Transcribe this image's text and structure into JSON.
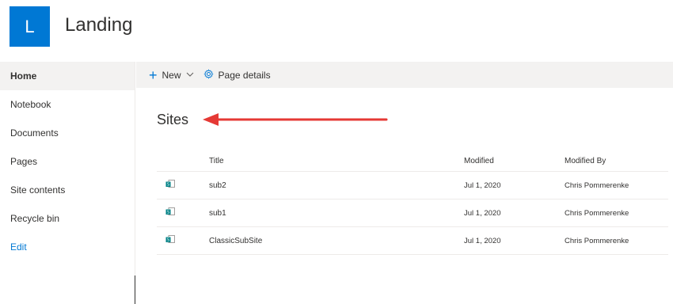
{
  "header": {
    "logo_letter": "L",
    "title": "Landing"
  },
  "nav": {
    "items": [
      {
        "label": "Home"
      },
      {
        "label": "Notebook"
      },
      {
        "label": "Documents"
      },
      {
        "label": "Pages"
      },
      {
        "label": "Site contents"
      },
      {
        "label": "Recycle bin"
      },
      {
        "label": "Edit"
      }
    ]
  },
  "command_bar": {
    "new_label": "New",
    "page_details_label": "Page details"
  },
  "sites": {
    "title": "Sites",
    "columns": {
      "title": "Title",
      "modified": "Modified",
      "modified_by": "Modified By"
    },
    "rows": [
      {
        "title": "sub2",
        "modified": "Jul 1, 2020",
        "modified_by": "Chris Pommerenke"
      },
      {
        "title": "sub1",
        "modified": "Jul 1, 2020",
        "modified_by": "Chris Pommerenke"
      },
      {
        "title": "ClassicSubSite",
        "modified": "Jul 1, 2020",
        "modified_by": "Chris Pommerenke"
      }
    ]
  },
  "colors": {
    "accent": "#0078d4",
    "annotation_arrow": "#e53935",
    "command_bar_bg": "#f3f2f1"
  },
  "icons": {
    "new": "plus-icon",
    "dropdown": "chevron-down-icon",
    "page_details": "gear-icon",
    "site": "sharepoint-site-icon"
  }
}
